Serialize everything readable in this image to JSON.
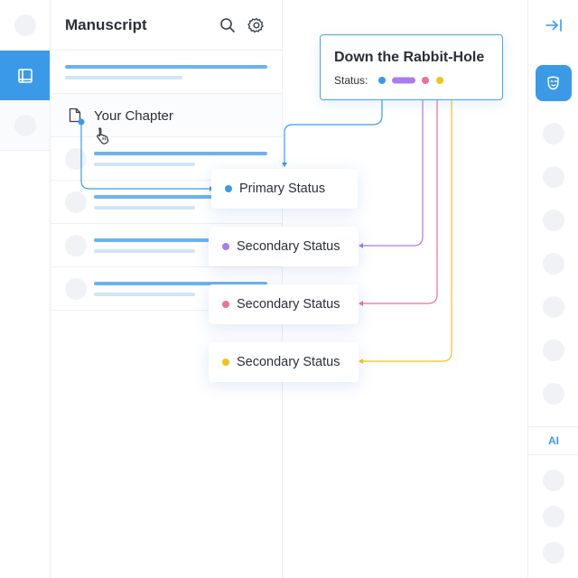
{
  "panel": {
    "title": "Manuscript"
  },
  "chapter": {
    "label": "Your Chapter"
  },
  "document": {
    "title": "Down the Rabbit-Hole",
    "status_label": "Status:"
  },
  "statuses": [
    {
      "label": "Primary Status",
      "color": "#3b9ae8"
    },
    {
      "label": "Secondary Status",
      "color": "#a77cf0"
    },
    {
      "label": "Secondary Status",
      "color": "#ee6f9a"
    },
    {
      "label": "Secondary Status",
      "color": "#f2c21b"
    }
  ],
  "right_rail": {
    "ai_label": "AI"
  },
  "icons": {
    "rail_active": "book-icon",
    "search": "search-icon",
    "settings": "gear-icon",
    "chapter": "document-icon",
    "cursor": "hand-pointer-icon",
    "collapse": "collapse-right-icon",
    "right_active": "mask-icon"
  },
  "colors": {
    "accent": "#3b9ae8",
    "purple": "#a77cf0",
    "pink": "#ee6f9a",
    "yellow": "#f2c21b"
  }
}
